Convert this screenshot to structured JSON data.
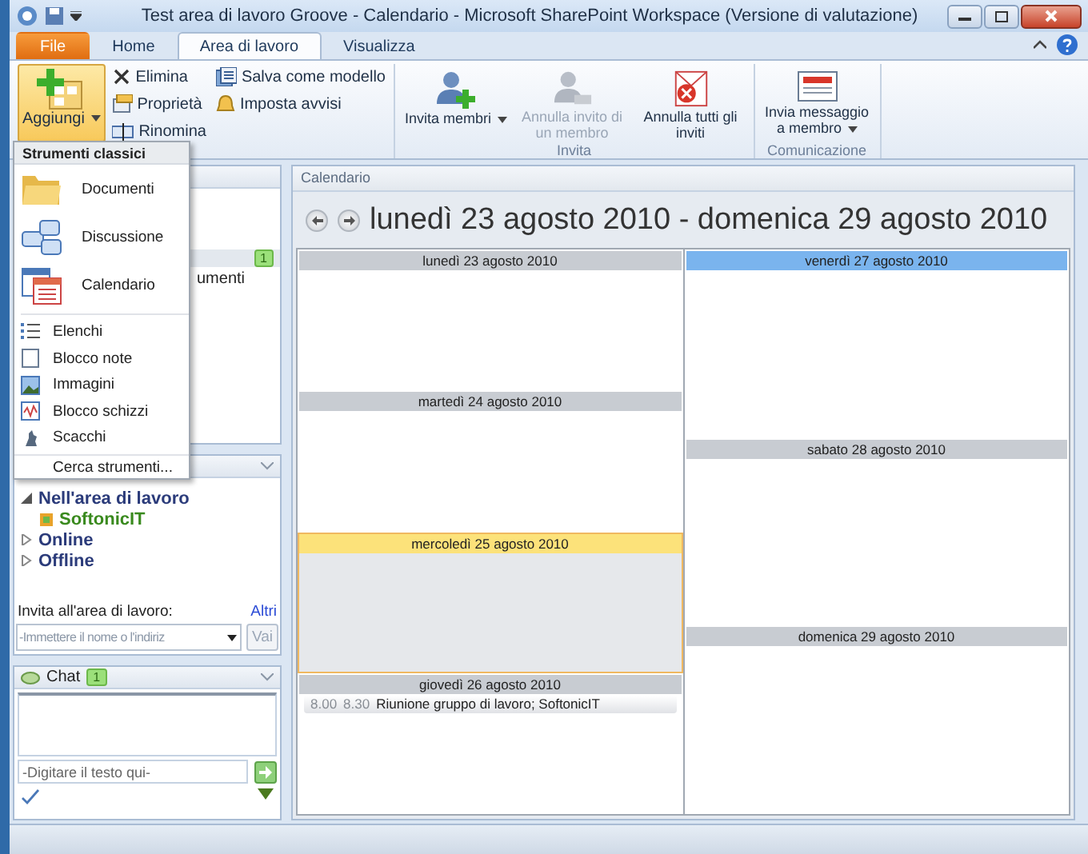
{
  "window": {
    "title": "Test area di lavoro Groove - Calendario  -  Microsoft SharePoint Workspace (Versione di valutazione)"
  },
  "tabs": [
    {
      "label": "File",
      "kind": "file",
      "selected": false
    },
    {
      "label": "Home",
      "kind": "tab",
      "selected": false
    },
    {
      "label": "Area di lavoro",
      "kind": "tab",
      "selected": true
    },
    {
      "label": "Visualizza",
      "kind": "tab",
      "selected": false
    }
  ],
  "ribbon": {
    "groups": [
      {
        "buttons": [
          {
            "label": "Aggiungi",
            "selected": true,
            "disabled": false,
            "dropdown": true
          }
        ],
        "columns": [
          [
            {
              "label": "Elimina"
            },
            {
              "label": "Proprietà"
            },
            {
              "label": "Rinomina"
            }
          ],
          [
            {
              "label": "Salva come modello"
            },
            {
              "label": "Imposta avvisi"
            }
          ]
        ]
      },
      {
        "label": "Invita",
        "buttons": [
          {
            "label": "Invita membri",
            "selected": false,
            "disabled": false,
            "dropdown": true
          },
          {
            "label": "Annulla invito di un membro",
            "selected": false,
            "disabled": true,
            "dropdown": false
          },
          {
            "label": "Annulla tutti gli inviti",
            "selected": false,
            "disabled": false,
            "dropdown": false
          }
        ]
      },
      {
        "label": "Comunicazione",
        "buttons": [
          {
            "label": "Invia messaggio a membro",
            "selected": false,
            "disabled": false,
            "dropdown": true
          }
        ]
      }
    ]
  },
  "menu": {
    "title": "Strumenti classici",
    "items": [
      {
        "label": "Documenti",
        "kind": "large"
      },
      {
        "label": "Discussione",
        "kind": "large"
      },
      {
        "label": "Calendario",
        "kind": "large"
      },
      {
        "label": "Elenchi",
        "kind": "small"
      },
      {
        "label": "Blocco note",
        "kind": "small"
      },
      {
        "label": "Immagini",
        "kind": "small"
      },
      {
        "label": "Blocco schizzi",
        "kind": "small"
      },
      {
        "label": "Scacchi",
        "kind": "small"
      },
      {
        "label": "Cerca strumenti...",
        "kind": "link"
      }
    ]
  },
  "tools_panel": {
    "badge": "1",
    "row_text": "umenti"
  },
  "members": {
    "tree": [
      {
        "label": "Nell'area di lavoro",
        "expanded": true,
        "children": [
          {
            "label": "SoftonicIT"
          }
        ]
      },
      {
        "label": "Online",
        "expanded": false
      },
      {
        "label": "Offline",
        "expanded": false
      }
    ],
    "invite_label": "Invita all'area di lavoro:",
    "more_link": "Altri",
    "invite_field": {
      "placeholder": "-Immettere il nome o l'indiriz"
    },
    "go_button": {
      "label": "Vai",
      "disabled": true
    }
  },
  "chat": {
    "title": "Chat",
    "badge": "1",
    "input": {
      "placeholder": "-Digitare il testo qui-"
    }
  },
  "calendar": {
    "panel_title": "Calendario",
    "range": "lunedì 23 agosto 2010 - domenica 29 agosto 2010",
    "columns": [
      [
        {
          "label": "lunedì 23 agosto 2010",
          "selected": false,
          "today": false
        },
        {
          "label": "martedì 24 agosto 2010",
          "selected": false,
          "today": false
        },
        {
          "label": "mercoledì 25 agosto 2010",
          "selected": true,
          "today": false
        },
        {
          "label": "giovedì 26 agosto 2010",
          "selected": false,
          "today": false,
          "events": [
            {
              "start": "8.00",
              "end": "8.30",
              "title": "Riunione gruppo di lavoro; SoftonicIT"
            }
          ]
        }
      ],
      [
        {
          "label": "venerdì 27 agosto 2010",
          "selected": false,
          "today": true
        },
        {
          "label": "sabato 28 agosto 2010",
          "selected": false,
          "today": false
        },
        {
          "label": "domenica 29 agosto 2010",
          "selected": false,
          "today": false
        }
      ]
    ]
  }
}
